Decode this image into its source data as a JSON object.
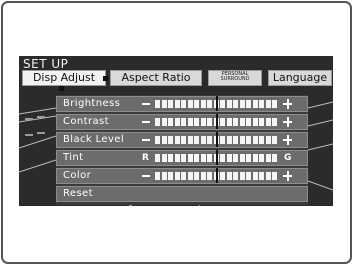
{
  "screen": {
    "title": "SET UP",
    "tabs": [
      {
        "label": "Disp Adjust"
      },
      {
        "label": "Aspect Ratio"
      },
      {
        "line1": "PERSONAL",
        "line2": "SURROUND"
      },
      {
        "label": "Language"
      }
    ],
    "settings": [
      {
        "label": "Brightness",
        "left": "minus",
        "right": "plus",
        "level": 0.5
      },
      {
        "label": "Contrast",
        "left": "minus",
        "right": "plus",
        "level": 0.5
      },
      {
        "label": "Black Level",
        "left": "minus",
        "right": "plus",
        "level": 0.5
      },
      {
        "label": "Tint",
        "left_text": "R",
        "right_text": "G",
        "level": 0.5
      },
      {
        "label": "Color",
        "left": "minus",
        "right": "plus",
        "level": 0.5
      }
    ],
    "reset_label": "Reset",
    "colors": {
      "screen_bg": "#2b2b2b",
      "row_bg": "#6c6c6c",
      "tab_bg": "#d9d9d9"
    }
  }
}
